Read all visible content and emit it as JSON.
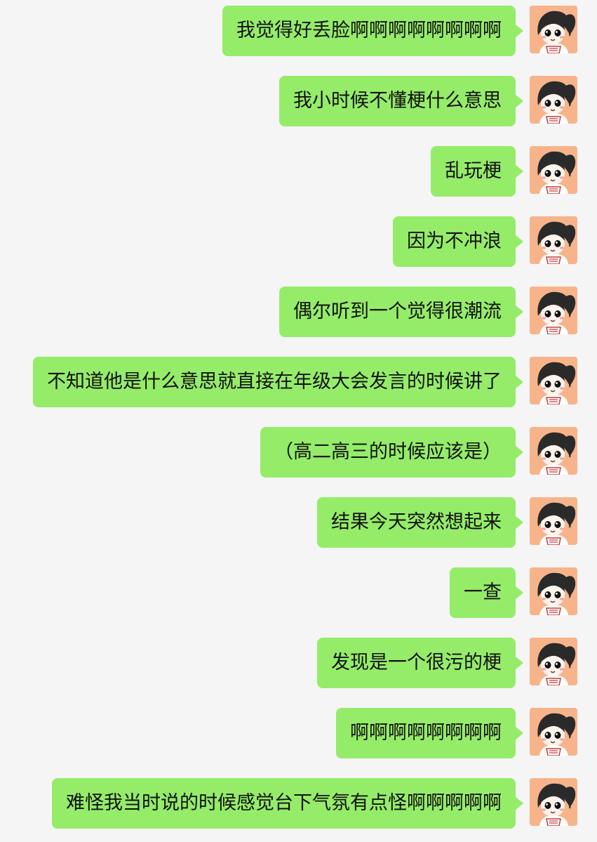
{
  "conversation": {
    "messages": [
      {
        "text": "我觉得好丢脸啊啊啊啊啊啊啊啊",
        "sender": "self"
      },
      {
        "text": "我小时候不懂梗什么意思",
        "sender": "self"
      },
      {
        "text": "乱玩梗",
        "sender": "self"
      },
      {
        "text": "因为不冲浪",
        "sender": "self"
      },
      {
        "text": "偶尔听到一个觉得很潮流",
        "sender": "self"
      },
      {
        "text": "不知道他是什么意思就直接在年级大会发言的时候讲了",
        "sender": "self"
      },
      {
        "text": "（高二高三的时候应该是）",
        "sender": "self"
      },
      {
        "text": "结果今天突然想起来",
        "sender": "self"
      },
      {
        "text": "一查",
        "sender": "self"
      },
      {
        "text": "发现是一个很污的梗",
        "sender": "self"
      },
      {
        "text": "啊啊啊啊啊啊啊啊",
        "sender": "self"
      },
      {
        "text": "难怪我当时说的时候感觉台下气氛有点怪啊啊啊啊啊",
        "sender": "self"
      }
    ]
  },
  "colors": {
    "background": "#f5f5f5",
    "bubble": "#95ec69",
    "text": "#111111",
    "avatar_bg": "#f7b48a"
  },
  "icons": {
    "avatar": "cartoon-girl-avatar-icon"
  }
}
